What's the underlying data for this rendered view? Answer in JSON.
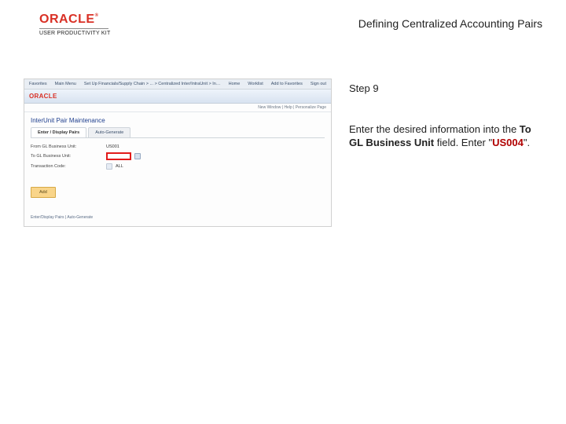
{
  "header": {
    "brand_name": "ORACLE",
    "product_kit": "USER PRODUCTIVITY KIT",
    "title": "Defining Centralized Accounting Pairs"
  },
  "screenshot": {
    "menubar": {
      "item1": "Favorites",
      "item2": "Main Menu",
      "breadcrumb": "Set Up Financials/Supply Chain >  ... > Centralized Inter/IntraUnit >  InterUnit Pair",
      "home": "Home",
      "worklist": "Worklist",
      "addfav": "Add to Favorites",
      "signout": "Sign out"
    },
    "appbar": {
      "brand": "ORACLE",
      "newwin": "New Window",
      "pers": "Personalize Page"
    },
    "breadline": "New Window | Help | Personalize Page",
    "page_title": "InterUnit Pair Maintenance",
    "tabs": {
      "t1": "Enter / Display Pairs",
      "t2": "Auto-Generate"
    },
    "form": {
      "row1_lbl": "From GL Business Unit:",
      "row1_val": "US001",
      "row2_lbl": "To GL Business Unit:",
      "row2_after": "",
      "row3_lbl": "Transaction Code:",
      "row3_after": "ALL"
    },
    "add_btn": "Add",
    "footer_links": "Enter/Display Pairs | Auto-Generate"
  },
  "instructions": {
    "step_label": "Step 9",
    "body_pre": "Enter the desired information into the ",
    "field_name": "To GL Business Unit",
    "body_mid": " field. Enter ",
    "quote_open": "\"",
    "value": "US004",
    "quote_close": "\"",
    "body_end": "."
  }
}
